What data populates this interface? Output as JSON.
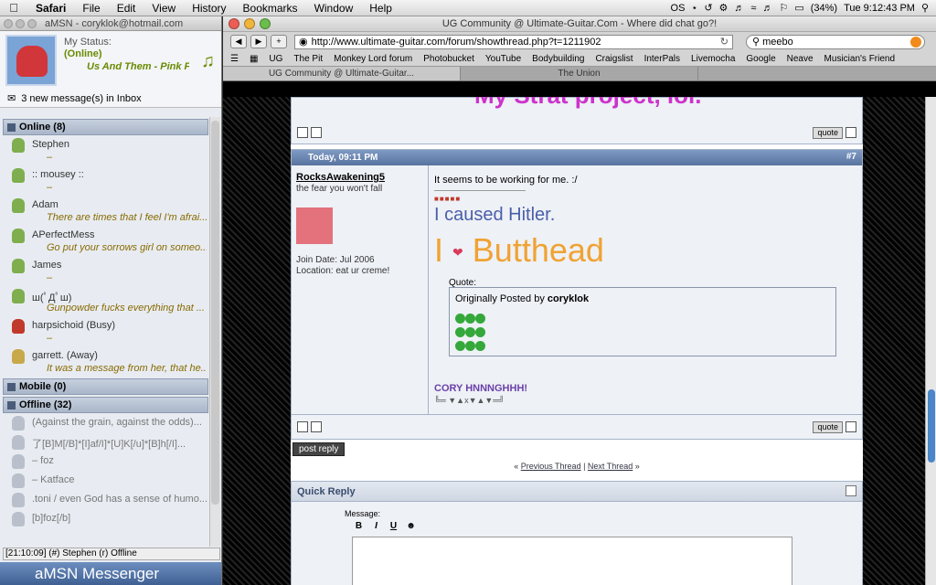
{
  "menubar": {
    "apple": "",
    "app": "Safari",
    "items": [
      "File",
      "Edit",
      "View",
      "History",
      "Bookmarks",
      "Window",
      "Help"
    ],
    "battery": "(34%)",
    "clock": "Tue 9:12:43 PM"
  },
  "amsn": {
    "window_title": "aMSN - coryklok@hotmail.com",
    "my_status_label": "My Status:",
    "my_status_value": "(Online)",
    "psm": "Us And Them - Pink Fl...",
    "inbox": "3 new message(s) in Inbox",
    "groups": {
      "online": "Online (8)",
      "mobile": "Mobile (0)",
      "offline": "Offline (32)"
    },
    "online_contacts": [
      {
        "name": "Stephen",
        "psm": "–"
      },
      {
        "name": ":: mousey ::",
        "psm": "–"
      },
      {
        "name": "Adam",
        "psm": "There are times that I feel I'm afrai..."
      },
      {
        "name": "APerfectMess",
        "psm": "Go put your sorrows girl on someo..."
      },
      {
        "name": "James",
        "psm": "–"
      },
      {
        "name": "ш(ﾟДﾟш)",
        "psm": "Gunpowder fucks everything that ..."
      },
      {
        "name": "harpsichoid (Busy)",
        "psm": "–"
      },
      {
        "name": "garrett. (Away)",
        "psm": "It was a message from her, that he..."
      }
    ],
    "offline_contacts": [
      {
        "name": "(Against the grain, against the odds)..."
      },
      {
        "name": "了[B]M[/B]*[I]af/I]*[U]K[/u]*[B]h[/I]..."
      },
      {
        "name": "– foz"
      },
      {
        "name": "– Katface"
      },
      {
        "name": ".toni / even God has a sense of humo..."
      },
      {
        "name": "[b]foz[/b]"
      }
    ],
    "statusbar": "[21:10:09] (#) Stephen (r) Offline",
    "banner": "aMSN Messenger"
  },
  "safari": {
    "window_title": "UG Community @ Ultimate-Guitar.Com - Where did chat go?!",
    "url": "http://www.ultimate-guitar.com/forum/showthread.php?t=1211902",
    "search": "meebo",
    "bookmarks": [
      "UG",
      "The Pit",
      "Monkey Lord forum",
      "Photobucket",
      "YouTube",
      "Bodybuilding",
      "Craigslist",
      "InterPals",
      "Livemocha",
      "Google",
      "Neave",
      "Musician's Friend"
    ],
    "tabs": [
      "UG Community @ Ultimate-Guitar...",
      "The Union"
    ]
  },
  "forum": {
    "prev_post_title": "My Strat project, lol.",
    "quote_label": "quote",
    "post": {
      "date": "Today, 09:11 PM",
      "number": "#7",
      "username": "RocksAwakening5",
      "user_title": "the fear you won't fall",
      "join_date": "Join Date: Jul 2006",
      "location": "Location: eat ur creme!",
      "text1": "It seems to be working for me. :/",
      "sig_hitler": "I caused Hitler.",
      "sig_i": "I",
      "sig_butthead": "Butthead",
      "quote_label": "Quote:",
      "quote_originally": "Originally Posted by",
      "quote_author": "coryklok",
      "cory": "CORY HNNNGHHH!",
      "deco": "╚═ ▼▲x▼▲▼═╝"
    },
    "post_reply": "post reply",
    "prev_thread": "Previous Thread",
    "next_thread": "Next Thread",
    "quick_reply": "Quick Reply",
    "message_label": "Message:",
    "editor_buttons": [
      "B",
      "I",
      "U"
    ]
  }
}
